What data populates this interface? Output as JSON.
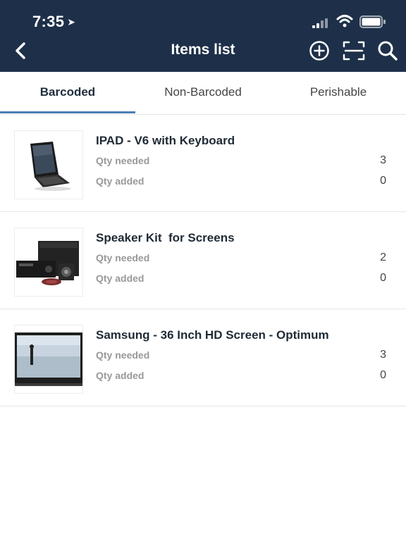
{
  "status_bar": {
    "time": "7:35",
    "location_icon": "location-arrow-icon"
  },
  "header": {
    "title": "Items list",
    "icons": [
      "back-chevron-icon",
      "add-circle-icon",
      "barcode-scan-icon",
      "search-icon"
    ]
  },
  "tabs": [
    {
      "label": "Barcoded",
      "active": true
    },
    {
      "label": "Non-Barcoded",
      "active": false
    },
    {
      "label": "Perishable",
      "active": false
    }
  ],
  "items": [
    {
      "name": "IPAD - V6 with Keyboard",
      "qty_needed_label": "Qty needed",
      "qty_needed": "3",
      "qty_added_label": "Qty added",
      "qty_added": "0"
    },
    {
      "name": "Speaker Kit  for Screens",
      "qty_needed_label": "Qty needed",
      "qty_needed": "2",
      "qty_added_label": "Qty added",
      "qty_added": "0"
    },
    {
      "name": "Samsung - 36 Inch HD Screen - Optimum",
      "qty_needed_label": "Qty needed",
      "qty_needed": "3",
      "qty_added_label": "Qty added",
      "qty_added": "0"
    }
  ],
  "colors": {
    "header_bg": "#1e3049",
    "tab_indicator": "#4a7fb8"
  }
}
